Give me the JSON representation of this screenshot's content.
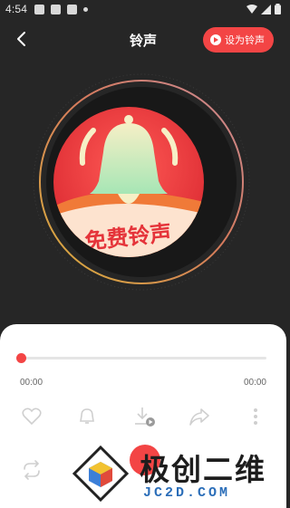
{
  "status_bar": {
    "time": "4:54"
  },
  "header": {
    "title": "铃声",
    "set_ringtone_label": "设为铃声"
  },
  "cover": {
    "label": "免费铃声",
    "icon": "bell-icon"
  },
  "player": {
    "current_time": "00:00",
    "total_time": "00:00",
    "progress": 0,
    "actions": [
      "heart-icon",
      "bell-icon",
      "download-icon",
      "share-icon",
      "more-icon"
    ],
    "loop_icon": "loop-icon"
  },
  "watermark": {
    "name": "极创二维",
    "domain": "JC2D.COM"
  },
  "colors": {
    "accent": "#f34545",
    "background": "#262626",
    "panel": "#ffffff"
  }
}
